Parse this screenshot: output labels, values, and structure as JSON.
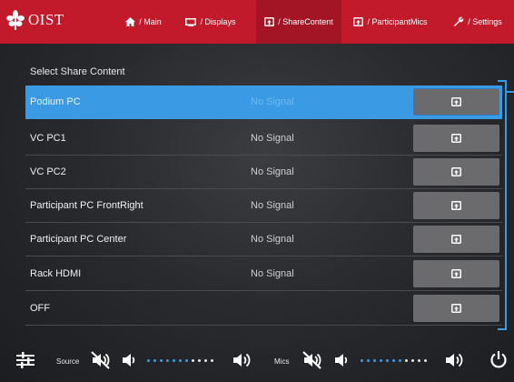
{
  "app": {
    "logo_text": "OIST"
  },
  "nav": {
    "tabs": [
      {
        "label": "/ Main",
        "icon": "home-icon"
      },
      {
        "label": "/ Displays",
        "icon": "display-icon"
      },
      {
        "label": "/ ShareContent",
        "icon": "share-icon",
        "active": true
      },
      {
        "label": "/ ParticipantMics",
        "icon": "share-icon"
      },
      {
        "label": "/ Settings",
        "icon": "wrench-icon"
      }
    ]
  },
  "content": {
    "title": "Select Share Content",
    "sources": [
      {
        "name": "Podium PC",
        "status": "No Signal",
        "selected": true
      },
      {
        "name": "VC PC1",
        "status": "No Signal"
      },
      {
        "name": "VC PC2",
        "status": "No Signal"
      },
      {
        "name": "Participant PC FrontRight",
        "status": "No Signal"
      },
      {
        "name": "Participant PC Center",
        "status": "No Signal"
      },
      {
        "name": "Rack HDMI",
        "status": "No Signal"
      },
      {
        "name": "OFF",
        "status": ""
      }
    ]
  },
  "bottom": {
    "source_label": "Source",
    "mics_label": "Mics",
    "source_volume_dots_on": 7,
    "source_volume_dots_total": 11,
    "mics_volume_dots_on": 7,
    "mics_volume_dots_total": 11
  },
  "colors": {
    "brand": "#c31a2b",
    "selected": "#3a9be4",
    "dot_on": "#3a9be4",
    "dot_off": "#e6e6e6"
  }
}
